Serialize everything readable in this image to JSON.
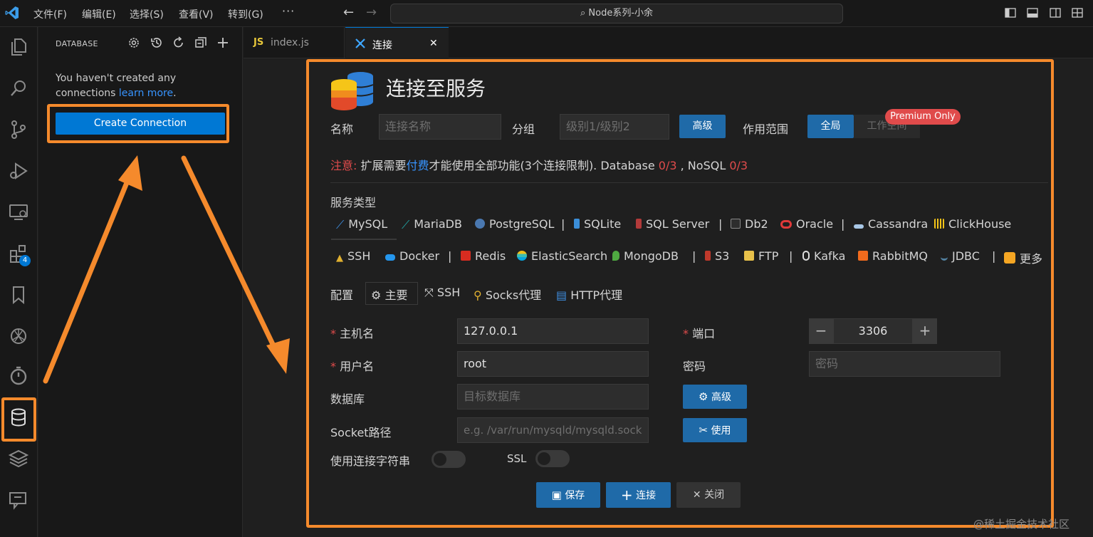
{
  "titlebar": {
    "menus": [
      "文件(F)",
      "编辑(E)",
      "选择(S)",
      "查看(V)",
      "转到(G)"
    ],
    "more": "···",
    "search_text": "Node系列-小余"
  },
  "sidebar": {
    "title": "DATABASE",
    "message": "You haven't created any connections",
    "learn_more": "learn more",
    "period": ".",
    "create_button": "Create Connection"
  },
  "activity": {
    "extensions_badge": "4"
  },
  "tabs": [
    {
      "icon": "JS",
      "label": "index.js"
    },
    {
      "label": "连接",
      "close": "✕"
    }
  ],
  "connection": {
    "title": "连接至服务",
    "name_label": "名称",
    "name_placeholder": "连接名称",
    "group_label": "分组",
    "group_placeholder": "级别1/级别2",
    "advanced_button": "高级",
    "scope_label": "作用范围",
    "scope_global": "全局",
    "scope_workspace": "工作空间",
    "premium_badge": "Premium Only",
    "notice": {
      "prefix": "注意:",
      "text1": " 扩展需要",
      "pay": "付费",
      "text2": "才能使用全部功能(3个连接限制). Database ",
      "db_count": "0/3",
      "text3": " , NoSQL ",
      "nosql_count": "0/3"
    },
    "service_type_label": "服务类型",
    "services_row1": [
      "MySQL",
      "MariaDB",
      "PostgreSQL",
      "SQLite",
      "SQL Server",
      "Db2",
      "Oracle",
      "Cassandra",
      "ClickHouse"
    ],
    "services_row2": [
      "SSH",
      "Docker",
      "Redis",
      "ElasticSearch",
      "MongoDB",
      "S3",
      "FTP",
      "Kafka",
      "RabbitMQ",
      "JDBC",
      "更多"
    ],
    "separator": "|",
    "config_label": "配置",
    "config_tabs": [
      "主要",
      "SSH",
      "Socks代理",
      "HTTP代理"
    ],
    "required_mark": "*",
    "host_label": "主机名",
    "host_value": "127.0.0.1",
    "port_label": "端口",
    "port_value": "3306",
    "port_minus": "−",
    "port_plus": "+",
    "user_label": "用户名",
    "user_value": "root",
    "password_label": "密码",
    "password_placeholder": "密码",
    "database_label": "数据库",
    "database_placeholder": "目标数据库",
    "advanced2_button": "高级",
    "socket_label": "Socket路径",
    "socket_placeholder": "e.g. /var/run/mysqld/mysqld.sock",
    "use_button": "使用",
    "use_conn_string_label": "使用连接字符串",
    "ssl_label": "SSL",
    "save_button": "保存",
    "connect_button": "连接",
    "close_button": "关闭"
  },
  "watermark": "@稀土掘金技术社区",
  "colors": {
    "accent": "#0078d4",
    "annotation": "#f58a2c",
    "warning": "#e04b4b"
  }
}
